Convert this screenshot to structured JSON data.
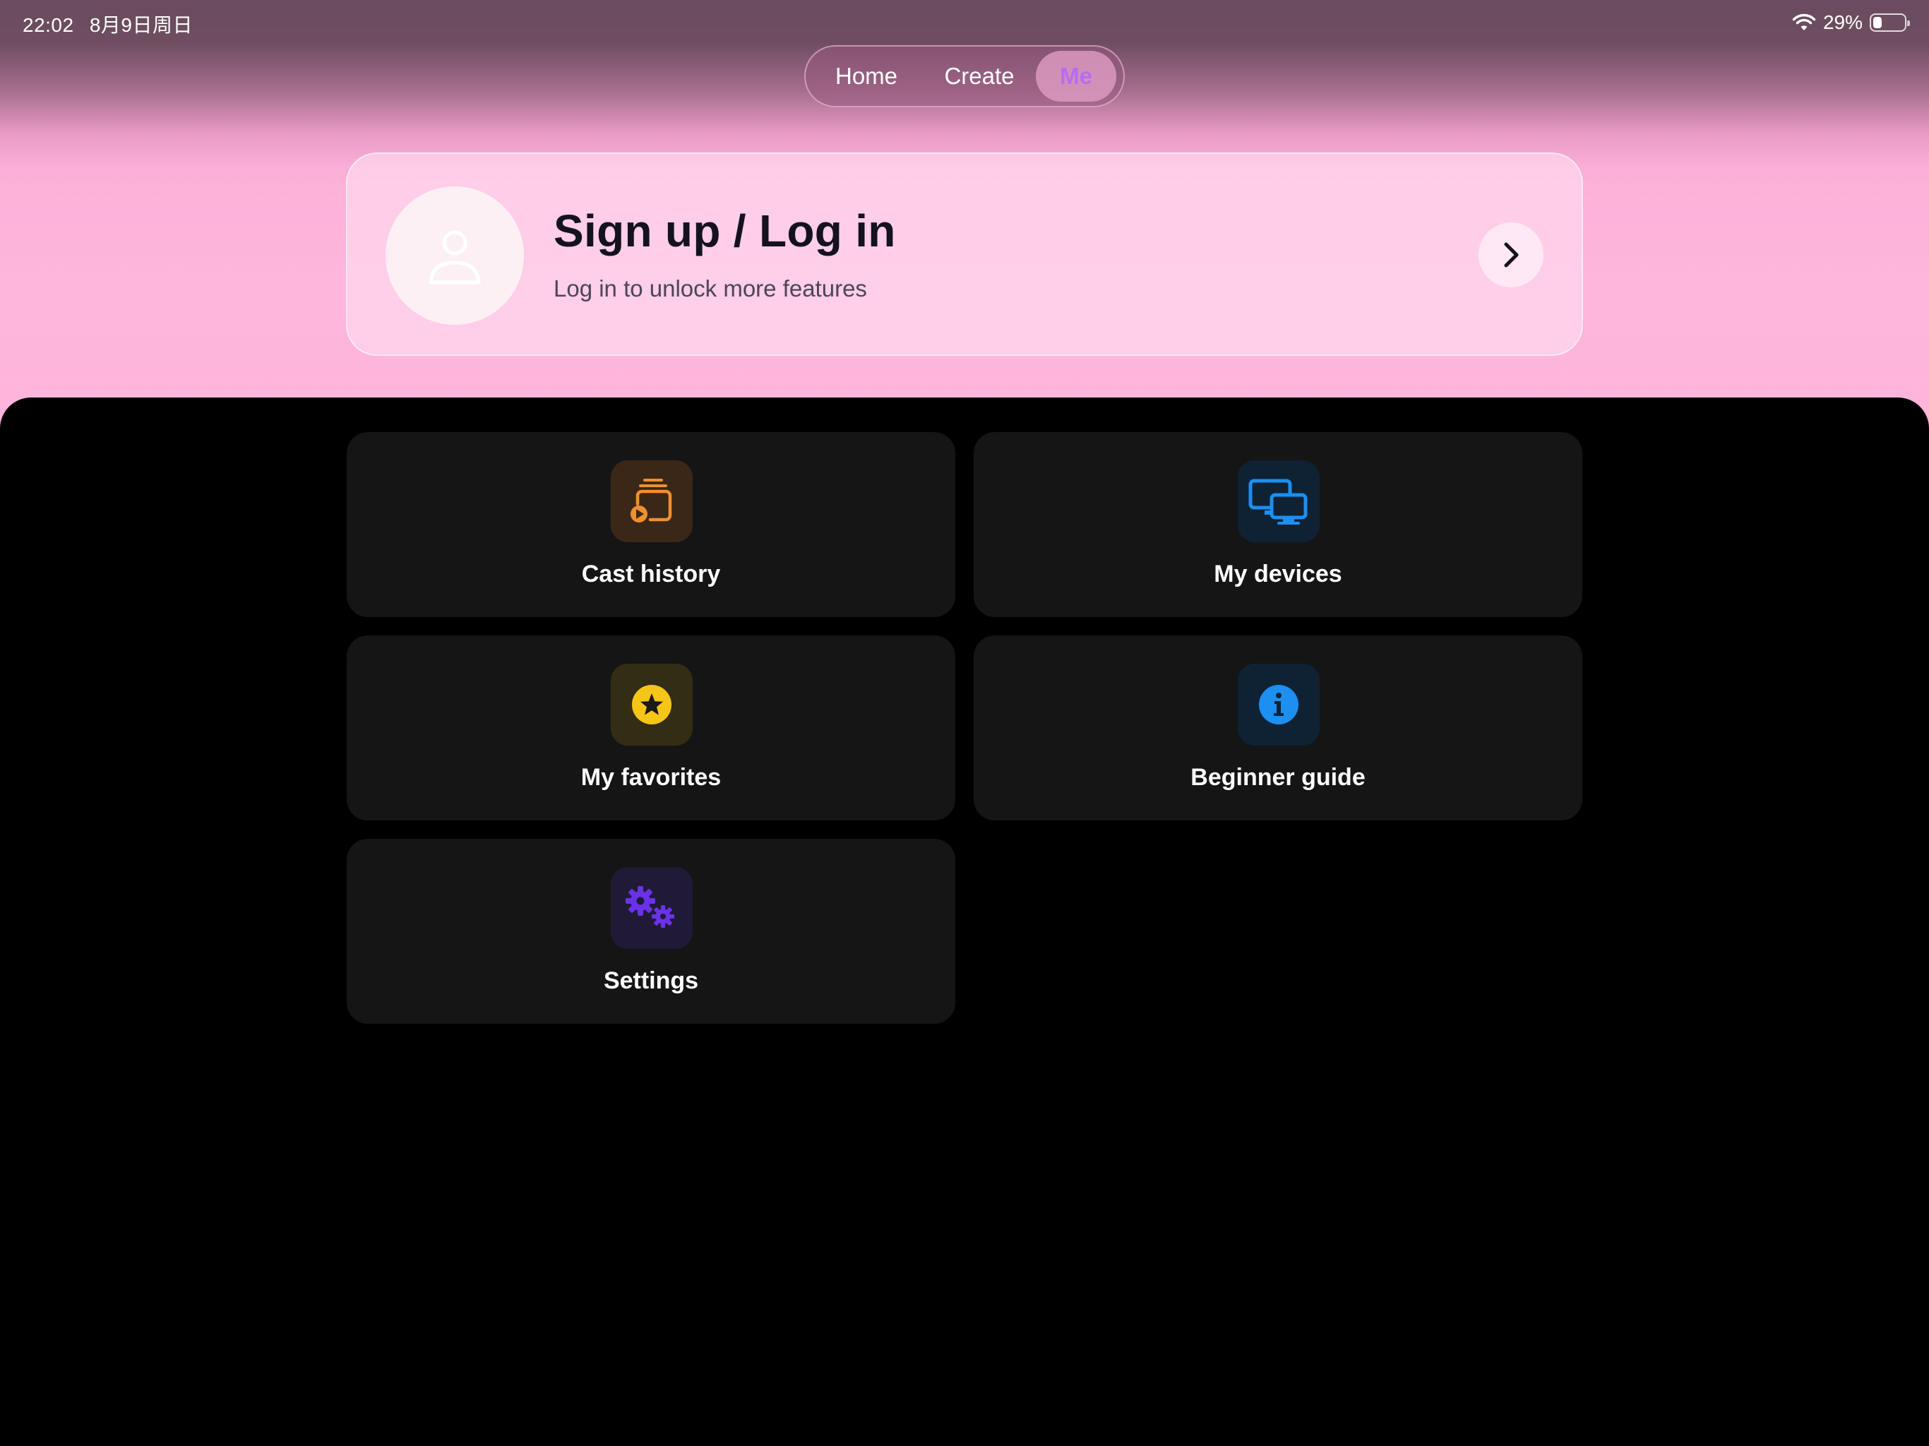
{
  "status_bar": {
    "time": "22:02",
    "date": "8月9日周日",
    "battery": "29%",
    "battery_level": 0.29
  },
  "nav": {
    "tabs": [
      {
        "label": "Home"
      },
      {
        "label": "Create"
      },
      {
        "label": "Me"
      }
    ],
    "selected": "Me"
  },
  "login_card": {
    "title": "Sign up / Log in",
    "subtitle": "Log in to unlock more features",
    "avatar_icon": "user-icon",
    "chevron_icon": "chevron-right-icon"
  },
  "menu": {
    "cast_history": {
      "label": "Cast history",
      "icon": "cast-history-icon",
      "color": "#f0902e"
    },
    "my_devices": {
      "label": "My devices",
      "icon": "devices-icon",
      "color": "#1c8ff0"
    },
    "my_favorites": {
      "label": "My favorites",
      "icon": "star-icon",
      "color": "#f5c518"
    },
    "beginner_guide": {
      "label": "Beginner guide",
      "icon": "info-icon",
      "color": "#1c8ff0"
    },
    "settings": {
      "label": "Settings",
      "icon": "gear-icon",
      "color": "#6a32e8"
    }
  },
  "colors": {
    "accent": "#b86cf0",
    "card_bg": "#151515",
    "header_pink": "#feb6dc"
  }
}
